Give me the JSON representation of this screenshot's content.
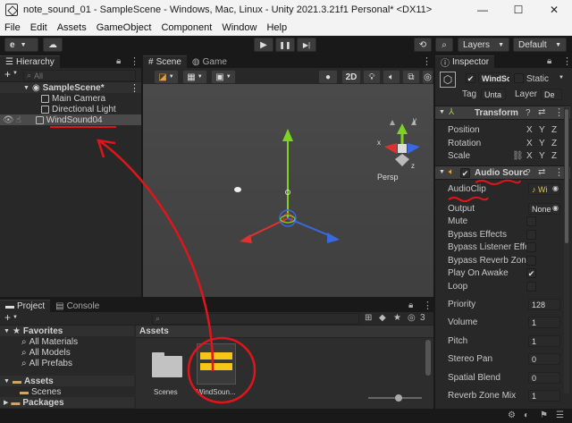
{
  "window": {
    "title": "note_sound_01 - SampleScene - Windows, Mac, Linux - Unity 2021.3.21f1 Personal* <DX11>",
    "minimize": "—",
    "maximize": "☐",
    "close": "✕"
  },
  "menu": [
    "File",
    "Edit",
    "Assets",
    "GameObject",
    "Component",
    "Window",
    "Help"
  ],
  "toolbar": {
    "account": "e",
    "play": "▶",
    "pause": "❚❚",
    "step": "▶|",
    "layers": "Layers",
    "layout": "Default"
  },
  "hierarchy": {
    "tab": "Hierarchy",
    "add": "+",
    "search_placeholder": "All",
    "scene": "SampleScene*",
    "items": [
      "Main Camera",
      "Directional Light",
      "WindSound04"
    ]
  },
  "scene_view": {
    "tabs": [
      "Scene",
      "Game"
    ],
    "mode_2d": "2D",
    "persp_label": "Persp",
    "axes": {
      "x": "x",
      "y": "y",
      "z": "z"
    }
  },
  "project": {
    "tabs": [
      "Project",
      "Console"
    ],
    "add": "+",
    "favorites": {
      "label": "Favorites",
      "items": [
        "All Materials",
        "All Models",
        "All Prefabs"
      ]
    },
    "assets_tree": {
      "label": "Assets",
      "items": [
        "Scenes"
      ]
    },
    "packages": "Packages",
    "breadcrumb": "Assets",
    "assets": [
      {
        "name": "Scenes"
      },
      {
        "name": "WindSoun..."
      }
    ],
    "badge": "3"
  },
  "inspector": {
    "tab": "Inspector",
    "object_name": "WindSo",
    "static_label": "Static",
    "tag_label": "Tag",
    "tag_value": "Unta",
    "layer_label": "Layer",
    "layer_value": "De",
    "transform": {
      "title": "Transform",
      "rows": [
        "Position",
        "Rotation",
        "Scale"
      ],
      "axes": [
        "X",
        "Y",
        "Z"
      ]
    },
    "audio": {
      "title": "Audio Sourc",
      "audioclip_label": "AudioClip",
      "audioclip_value": "♪ Wi",
      "output_label": "Output",
      "output_value": "None",
      "checks": [
        {
          "label": "Mute",
          "checked": false
        },
        {
          "label": "Bypass Effects",
          "checked": false
        },
        {
          "label": "Bypass Listener Effec",
          "checked": false
        },
        {
          "label": "Bypass Reverb Zones",
          "checked": false
        },
        {
          "label": "Play On Awake",
          "checked": true
        },
        {
          "label": "Loop",
          "checked": false
        }
      ],
      "values": [
        {
          "label": "Priority",
          "value": "128"
        },
        {
          "label": "Volume",
          "value": "1"
        },
        {
          "label": "Pitch",
          "value": "1"
        },
        {
          "label": "Stereo Pan",
          "value": "0"
        },
        {
          "label": "Spatial Blend",
          "value": "0"
        },
        {
          "label": "Reverb Zone Mix",
          "value": "1"
        }
      ]
    }
  },
  "colors": {
    "annotation": "#e0151b",
    "selection": "#3e5f96",
    "axis_x": "#e03131",
    "axis_y": "#7ed321",
    "axis_z": "#3869e0"
  }
}
